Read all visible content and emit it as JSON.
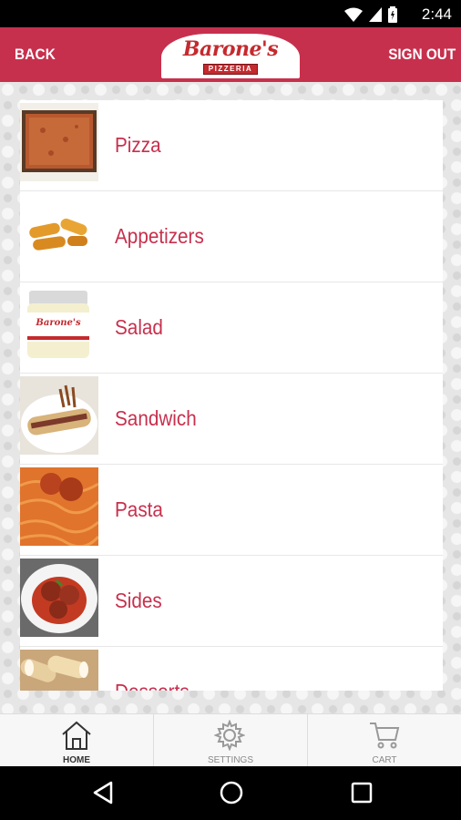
{
  "status_bar": {
    "time": "2:44",
    "icons": [
      "wifi-icon",
      "signal-icon",
      "battery-icon"
    ]
  },
  "app_bar": {
    "back_label": "BACK",
    "sign_out_label": "SIGN OUT",
    "logo": {
      "name": "Barone's",
      "subtitle": "PIZZERIA"
    },
    "color": "#c7304d"
  },
  "menu": {
    "label_color": "#c7304d",
    "items": [
      {
        "label": "Pizza",
        "thumbnail": "pizza-photo"
      },
      {
        "label": "Appetizers",
        "thumbnail": "appetizers-photo"
      },
      {
        "label": "Salad",
        "thumbnail": "salad-dressing-jar-photo"
      },
      {
        "label": "Sandwich",
        "thumbnail": "sandwich-photo"
      },
      {
        "label": "Pasta",
        "thumbnail": "pasta-photo"
      },
      {
        "label": "Sides",
        "thumbnail": "meatballs-photo"
      },
      {
        "label": "Desserts",
        "thumbnail": "cannoli-photo"
      }
    ]
  },
  "bottom_nav": {
    "items": [
      {
        "label": "HOME",
        "icon": "home-icon",
        "active": true
      },
      {
        "label": "SETTINGS",
        "icon": "gear-icon",
        "active": false
      },
      {
        "label": "CART",
        "icon": "cart-icon",
        "active": false
      }
    ]
  },
  "system_nav": {
    "buttons": [
      "back-triangle-icon",
      "home-circle-icon",
      "recents-square-icon"
    ]
  }
}
